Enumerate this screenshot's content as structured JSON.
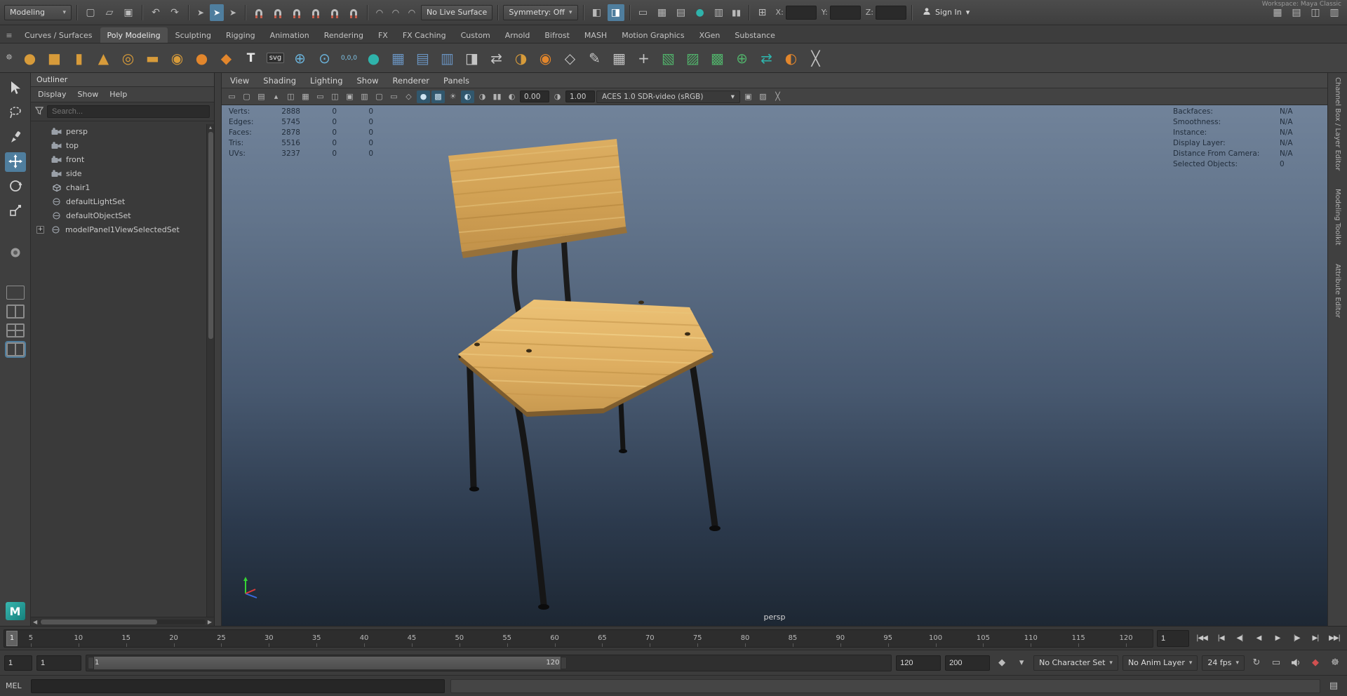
{
  "titlebar": {
    "workspace": "Workspace: Maya Classic"
  },
  "topbar": {
    "mode": "Modeling",
    "no_live_surface": "No Live Surface",
    "symmetry": "Symmetry: Off",
    "x_label": "X:",
    "y_label": "Y:",
    "z_label": "Z:",
    "sign_in": "Sign In"
  },
  "shelf_tabs": [
    "Curves / Surfaces",
    "Poly Modeling",
    "Sculpting",
    "Rigging",
    "Animation",
    "Rendering",
    "FX",
    "FX Caching",
    "Custom",
    "Arnold",
    "Bifrost",
    "MASH",
    "Motion Graphics",
    "XGen",
    "Substance"
  ],
  "shelf": {
    "text_tool": "T",
    "svg_tool": "svg",
    "coords": "0,0,0"
  },
  "outliner": {
    "title": "Outliner",
    "menus": [
      "Display",
      "Show",
      "Help"
    ],
    "search_placeholder": "Search...",
    "items": [
      {
        "label": "persp"
      },
      {
        "label": "top"
      },
      {
        "label": "front"
      },
      {
        "label": "side"
      },
      {
        "label": "chair1"
      },
      {
        "label": "defaultLightSet"
      },
      {
        "label": "defaultObjectSet"
      },
      {
        "label": "modelPanel1ViewSelectedSet"
      }
    ]
  },
  "viewport": {
    "menus": [
      "View",
      "Shading",
      "Lighting",
      "Show",
      "Renderer",
      "Panels"
    ],
    "exposure": "0.00",
    "gamma": "1.00",
    "colorspace": "ACES 1.0 SDR-video (sRGB)",
    "camera_label": "persp",
    "hud_left": [
      {
        "label": "Verts:",
        "value": "2888",
        "c2": "0",
        "c3": "0"
      },
      {
        "label": "Edges:",
        "value": "5745",
        "c2": "0",
        "c3": "0"
      },
      {
        "label": "Faces:",
        "value": "2878",
        "c2": "0",
        "c3": "0"
      },
      {
        "label": "Tris:",
        "value": "5516",
        "c2": "0",
        "c3": "0"
      },
      {
        "label": "UVs:",
        "value": "3237",
        "c2": "0",
        "c3": "0"
      }
    ],
    "hud_right": [
      {
        "label": "Backfaces:",
        "value": "N/A"
      },
      {
        "label": "Smoothness:",
        "value": "N/A"
      },
      {
        "label": "Instance:",
        "value": "N/A"
      },
      {
        "label": "Display Layer:",
        "value": "N/A"
      },
      {
        "label": "Distance From Camera:",
        "value": "N/A"
      },
      {
        "label": "Selected Objects:",
        "value": "0"
      }
    ]
  },
  "right_tabs": {
    "channel_box": "Channel Box / Layer Editor",
    "modeling_toolkit": "Modeling Toolkit",
    "attribute_editor": "Attribute Editor"
  },
  "timeline": {
    "current_frame": "1",
    "frame_field": "1",
    "ticks": [
      "5",
      "10",
      "15",
      "20",
      "25",
      "30",
      "35",
      "40",
      "45",
      "50",
      "55",
      "60",
      "65",
      "70",
      "75",
      "80",
      "85",
      "90",
      "95",
      "100",
      "105",
      "110",
      "115",
      "120"
    ]
  },
  "range": {
    "anim_start": "1",
    "playback_start": "1",
    "slider_start": "1",
    "slider_end": "120",
    "playback_end": "120",
    "anim_end": "200",
    "character_set": "No Character Set",
    "anim_layer": "No Anim Layer",
    "fps": "24 fps"
  },
  "command": {
    "label": "MEL"
  },
  "branding": {
    "logo_letter": "M"
  },
  "playback": {
    "to_start": "|◀◀",
    "back_frame": "|◀",
    "back_key": "◀|",
    "play_back": "◀",
    "play": "▶",
    "fwd_key": "|▶",
    "fwd_frame": "▶|",
    "to_end": "▶▶|"
  },
  "icons": {
    "caret": "▾",
    "caret_up": "▴",
    "left": "◀",
    "right": "▶",
    "menu": "≡",
    "gear": "☸",
    "new_scene": "▢",
    "open_scene": "▱",
    "save_scene": "▣",
    "undo": "↶",
    "redo": "↷",
    "cursor": "➤",
    "arc": "◠",
    "pane_left": "◧",
    "pane_right": "◨",
    "film": "▭",
    "grid": "▦",
    "rows": "▤",
    "cols": "▥",
    "teal_ball": "●",
    "pause": "▮▮",
    "plus_grid": "⊞",
    "sphere": "●",
    "cube": "■",
    "cylinder": "▮",
    "cone": "▲",
    "torus": "◎",
    "plane": "▬",
    "disc": "◉",
    "super": "●",
    "platonic": "◆",
    "lens_plus": "⊕",
    "lens_dot": "⊙",
    "mirror": "◨",
    "swap": "⇄",
    "wedge": "◑",
    "pair": "◉",
    "gem": "◇",
    "pencil": "✎",
    "plus": "+",
    "shade1": "▧",
    "shade2": "▨",
    "shade3": "▩",
    "cross": "╳",
    "sun": "☀",
    "contrast": "◐",
    "half2": "◑",
    "wire": "◇",
    "box": "▢",
    "boxgrid": "◫",
    "target": "◎",
    "diamond_key": "◆",
    "loop": "↻",
    "star": "★"
  }
}
